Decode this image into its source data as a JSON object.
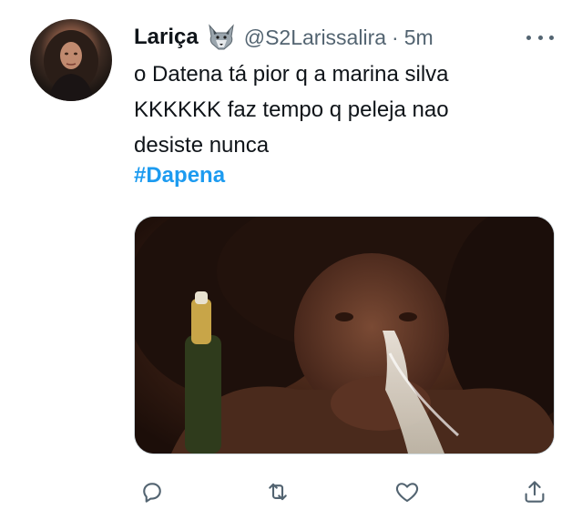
{
  "tweet": {
    "author": {
      "display_name": "Lariça",
      "name_emoji": "wolf-emoji",
      "handle": "@S2Larissalira",
      "separator": "·",
      "time": "5m"
    },
    "text_lines": [
      "o Datena tá pior q a marina silva",
      "KKKKKK faz tempo q peleja nao",
      "desiste nunca"
    ],
    "hashtag": "#Dapena",
    "media": {
      "type": "image",
      "description_icon": "photo-media"
    },
    "actions": [
      {
        "name": "reply",
        "icon": "reply-icon"
      },
      {
        "name": "retweet",
        "icon": "retweet-icon"
      },
      {
        "name": "like",
        "icon": "heart-icon"
      },
      {
        "name": "share",
        "icon": "share-icon"
      }
    ]
  },
  "colors": {
    "text": "#0f1419",
    "secondary": "#536471",
    "link": "#1d9bf0",
    "border": "#cfd9de"
  }
}
